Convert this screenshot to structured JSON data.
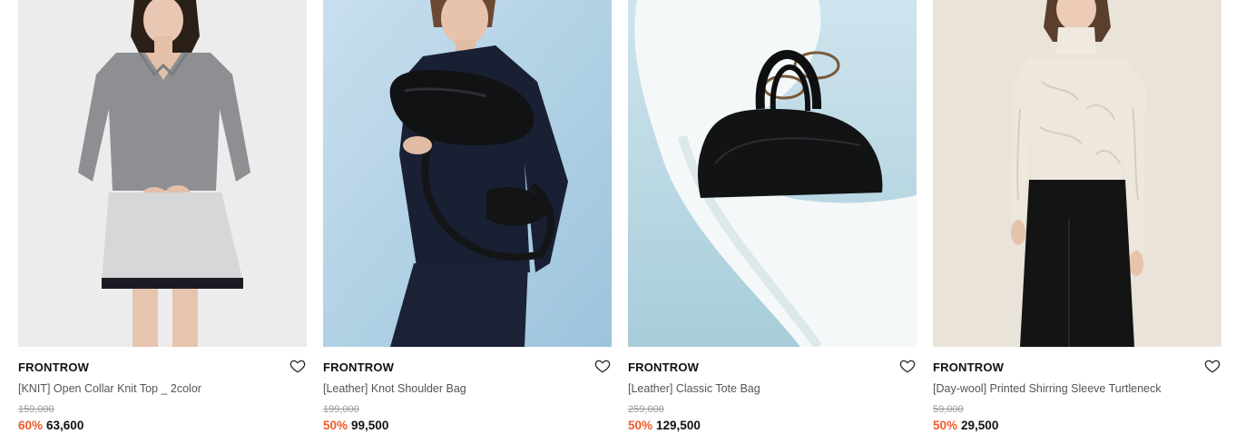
{
  "accent_discount_color": "#f05a28",
  "products": [
    {
      "brand": "FRONTROW",
      "name": "[KNIT] Open Collar Knit Top _ 2color",
      "original_price": "159,000",
      "discount": "60%",
      "sale_price": "63,600",
      "image": "gray-knit-top-photo"
    },
    {
      "brand": "FRONTROW",
      "name": "[Leather] Knot Shoulder Bag",
      "original_price": "199,000",
      "discount": "50%",
      "sale_price": "99,500",
      "image": "black-shoulder-bag-photo"
    },
    {
      "brand": "FRONTROW",
      "name": "[Leather] Classic Tote Bag",
      "original_price": "259,000",
      "discount": "50%",
      "sale_price": "129,500",
      "image": "black-tote-bag-photo"
    },
    {
      "brand": "FRONTROW",
      "name": "[Day-wool] Printed Shirring Sleeve Turtleneck",
      "original_price": "59,000",
      "discount": "50%",
      "sale_price": "29,500",
      "image": "ivory-turtleneck-photo"
    }
  ],
  "icons": {
    "wishlist": "heart-outline-icon"
  }
}
